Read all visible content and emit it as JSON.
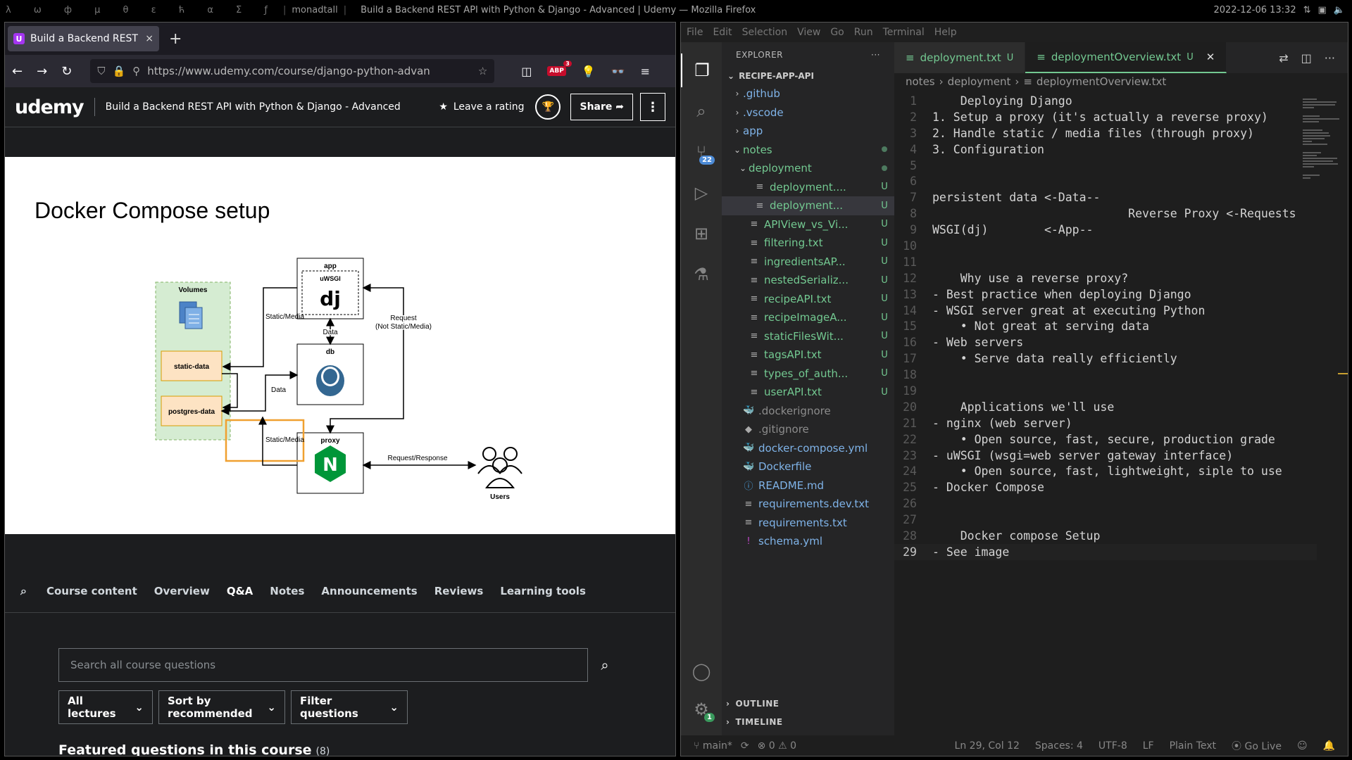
{
  "sysbar": {
    "glyphs": "λ ω ф μ θ ε ћ α Σ ƒ",
    "layout": "monadtall",
    "window_title": "Build a Backend REST API with Python & Django - Advanced | Udemy — Mozilla Firefox",
    "datetime": "2022-12-06 13:32"
  },
  "firefox": {
    "tab_title": "Build a Backend REST AP",
    "tab_close": "×",
    "new_tab": "+",
    "url": "https://www.udemy.com/course/django-python-advan",
    "abp_count": "3"
  },
  "udemy": {
    "logo": "udemy",
    "course_title": "Build a Backend REST API with Python & Django - Advanced",
    "leave_rating": "Leave a rating",
    "share": "Share",
    "slide": {
      "title": "Docker Compose setup",
      "volumes": "Volumes",
      "static_data": "static-data",
      "postgres_data": "postgres-data",
      "app": "app",
      "uwsgi": "uWSGI",
      "dj": "dj",
      "db": "db",
      "proxy": "proxy",
      "users": "Users",
      "static_media_1": "Static/Media",
      "static_media_2": "Static/Media",
      "data_1": "Data",
      "data_2": "Data",
      "request": "Request",
      "not_static": "(Not Static/Media)",
      "req_resp": "Request/Response"
    },
    "tabs": [
      "Course content",
      "Overview",
      "Q&A",
      "Notes",
      "Announcements",
      "Reviews",
      "Learning tools"
    ],
    "qa": {
      "search_placeholder": "Search all course questions",
      "filter_lectures": "All lectures",
      "filter_sort": "Sort by recommended",
      "filter_questions": "Filter questions",
      "featured": "Featured questions in this course",
      "featured_count": "(8)"
    }
  },
  "vscode": {
    "menu": [
      "File",
      "Edit",
      "Selection",
      "View",
      "Go",
      "Run",
      "Terminal",
      "Help"
    ],
    "explorer_title": "EXPLORER",
    "explorer_more": "···",
    "root": "RECIPE-APP-API",
    "source_control_badge": "22",
    "settings_badge": "1",
    "tree": [
      {
        "name": ".github",
        "type": "folder",
        "indent": 1,
        "status": "",
        "kind": "plain"
      },
      {
        "name": ".vscode",
        "type": "folder",
        "indent": 1,
        "status": "",
        "kind": "plain"
      },
      {
        "name": "app",
        "type": "folder",
        "indent": 1,
        "status": "",
        "kind": "plain"
      },
      {
        "name": "notes",
        "type": "folder-open",
        "indent": 1,
        "status": "dot",
        "kind": "mod"
      },
      {
        "name": "deployment",
        "type": "folder-open",
        "indent": 2,
        "status": "dot",
        "kind": "mod"
      },
      {
        "name": "deployment....",
        "type": "file",
        "indent": 3,
        "status": "U",
        "kind": "mod"
      },
      {
        "name": "deployment...",
        "type": "file",
        "indent": 3,
        "status": "U",
        "kind": "mod",
        "selected": true
      },
      {
        "name": "APIView_vs_Vi...",
        "type": "file",
        "indent": 2,
        "status": "U",
        "kind": "mod"
      },
      {
        "name": "filtering.txt",
        "type": "file",
        "indent": 2,
        "status": "U",
        "kind": "mod"
      },
      {
        "name": "ingredientsAP...",
        "type": "file",
        "indent": 2,
        "status": "U",
        "kind": "mod"
      },
      {
        "name": "nestedSerializ...",
        "type": "file",
        "indent": 2,
        "status": "U",
        "kind": "mod"
      },
      {
        "name": "recipeAPI.txt",
        "type": "file",
        "indent": 2,
        "status": "U",
        "kind": "mod"
      },
      {
        "name": "recipeImageA...",
        "type": "file",
        "indent": 2,
        "status": "U",
        "kind": "mod"
      },
      {
        "name": "staticFilesWit...",
        "type": "file",
        "indent": 2,
        "status": "U",
        "kind": "mod"
      },
      {
        "name": "tagsAPI.txt",
        "type": "file",
        "indent": 2,
        "status": "U",
        "kind": "mod"
      },
      {
        "name": "types_of_auth...",
        "type": "file",
        "indent": 2,
        "status": "U",
        "kind": "mod"
      },
      {
        "name": "userAPI.txt",
        "type": "file",
        "indent": 2,
        "status": "U",
        "kind": "mod"
      },
      {
        "name": ".dockerignore",
        "type": "docker",
        "indent": 1,
        "status": "",
        "kind": "ign"
      },
      {
        "name": ".gitignore",
        "type": "git",
        "indent": 1,
        "status": "",
        "kind": "ign"
      },
      {
        "name": "docker-compose.yml",
        "type": "compose",
        "indent": 1,
        "status": "",
        "kind": "plain"
      },
      {
        "name": "Dockerfile",
        "type": "docker",
        "indent": 1,
        "status": "",
        "kind": "plain"
      },
      {
        "name": "README.md",
        "type": "info",
        "indent": 1,
        "status": "",
        "kind": "plain"
      },
      {
        "name": "requirements.dev.txt",
        "type": "file",
        "indent": 1,
        "status": "",
        "kind": "plain"
      },
      {
        "name": "requirements.txt",
        "type": "file",
        "indent": 1,
        "status": "",
        "kind": "plain"
      },
      {
        "name": "schema.yml",
        "type": "yaml",
        "indent": 1,
        "status": "",
        "kind": "plain"
      }
    ],
    "outline": "OUTLINE",
    "timeline": "TIMELINE",
    "tabs": [
      {
        "name": "deployment.txt",
        "status": "U",
        "active": false
      },
      {
        "name": "deploymentOverview.txt",
        "status": "U",
        "active": true
      }
    ],
    "breadcrumb": [
      "notes",
      "deployment",
      "deploymentOverview.txt"
    ],
    "code": [
      "    Deploying Django",
      "1. Setup a proxy (it's actually a reverse proxy)",
      "2. Handle static / media files (through proxy)",
      "3. Configuration",
      "",
      "",
      "persistent data <-Data--",
      "                            Reverse Proxy <-Requests",
      "WSGI(dj)        <-App--",
      "",
      "",
      "    Why use a reverse proxy?",
      "- Best practice when deploying Django",
      "- WSGI server great at executing Python",
      "    • Not great at serving data",
      "- Web servers",
      "    • Serve data really efficiently",
      "",
      "",
      "    Applications we'll use",
      "- nginx (web server)",
      "    • Open source, fast, secure, production grade",
      "- uWSGI (wsgi=web server gateway interface)",
      "    • Open source, fast, lightweight, siple to use",
      "- Docker Compose",
      "",
      "",
      "    Docker compose Setup",
      "- See image"
    ],
    "status": {
      "branch": "main*",
      "errors": "0",
      "warnings": "0",
      "position": "Ln 29, Col 12",
      "spaces": "Spaces: 4",
      "encoding": "UTF-8",
      "eol": "LF",
      "language": "Plain Text",
      "golive": "Go Live"
    }
  }
}
